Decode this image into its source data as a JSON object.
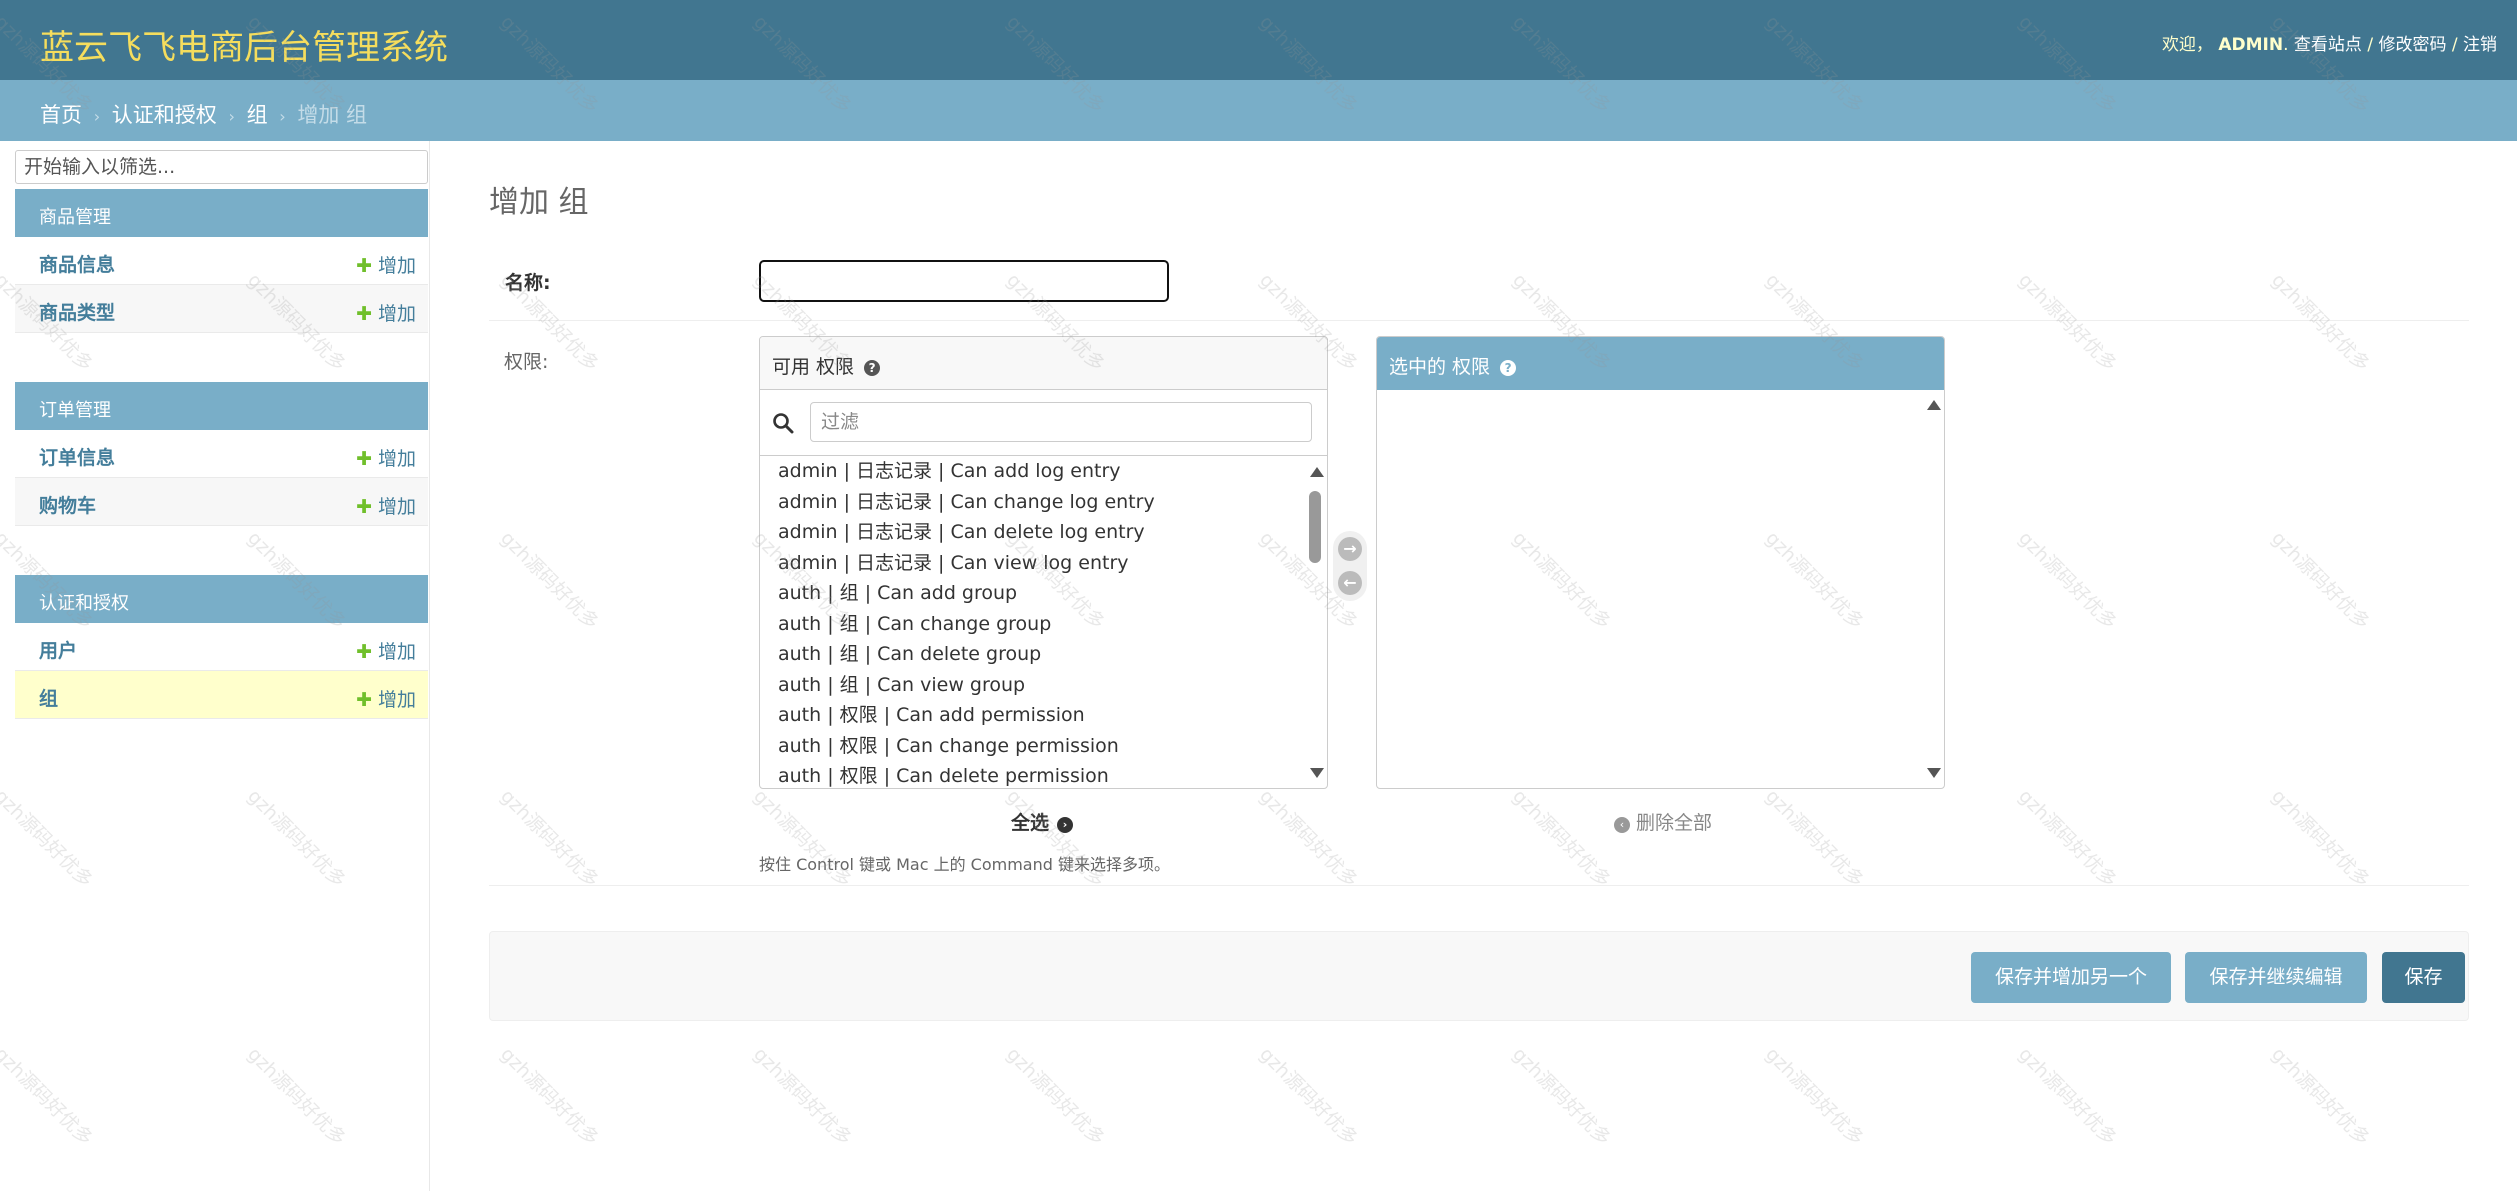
{
  "header": {
    "site_name": "蓝云飞飞电商后台管理系统",
    "welcome": "欢迎，",
    "username": "ADMIN",
    "view_site": "查看站点",
    "change_password": "修改密码",
    "logout": "注销",
    "separator": "/"
  },
  "breadcrumbs": {
    "items": [
      "首页",
      "认证和授权",
      "组"
    ],
    "current": "增加 组",
    "separator": "›"
  },
  "sidebar": {
    "filter_placeholder": "开始输入以筛选...",
    "apps": [
      {
        "name": "商品管理",
        "models": [
          {
            "name": "商品信息",
            "add": "增加"
          },
          {
            "name": "商品类型",
            "add": "增加"
          }
        ]
      },
      {
        "name": "订单管理",
        "models": [
          {
            "name": "订单信息",
            "add": "增加"
          },
          {
            "name": "购物车",
            "add": "增加"
          }
        ]
      },
      {
        "name": "认证和授权",
        "models": [
          {
            "name": "用户",
            "add": "增加"
          },
          {
            "name": "组",
            "add": "增加",
            "current": true
          }
        ]
      }
    ]
  },
  "main": {
    "title": "增加 组",
    "name_label": "名称:",
    "name_value": "",
    "permissions_label": "权限:",
    "available": {
      "title": "可用 权限",
      "filter_placeholder": "过滤",
      "options": [
        "admin | 日志记录 | Can add log entry",
        "admin | 日志记录 | Can change log entry",
        "admin | 日志记录 | Can delete log entry",
        "admin | 日志记录 | Can view log entry",
        "auth | 组 | Can add group",
        "auth | 组 | Can change group",
        "auth | 组 | Can delete group",
        "auth | 组 | Can view group",
        "auth | 权限 | Can add permission",
        "auth | 权限 | Can change permission",
        "auth | 权限 | Can delete permission"
      ]
    },
    "chosen": {
      "title": "选中的 权限",
      "options": []
    },
    "choose_all": "全选",
    "remove_all": "删除全部",
    "help_text": "按住 Control 键或 Mac 上的 Command 键来选择多项。",
    "help_icon": "?"
  },
  "submit": {
    "save_add_another": "保存并增加另一个",
    "save_continue": "保存并继续编辑",
    "save": "保存"
  },
  "watermark": {
    "text": "gzh源码好优多"
  },
  "colors": {
    "header_bg": "#417690",
    "breadcrumb_bg": "#79aec8",
    "site_name": "#f5dd5d",
    "link": "#447e9b",
    "add_green": "#70bf2b",
    "current_row": "#ffffcc"
  },
  "icons": {
    "search": "search-icon",
    "add_arrow": "arrow-right-circle-icon",
    "remove_arrow": "arrow-left-circle-icon",
    "help": "question-circle-icon",
    "plus": "plus-icon"
  }
}
